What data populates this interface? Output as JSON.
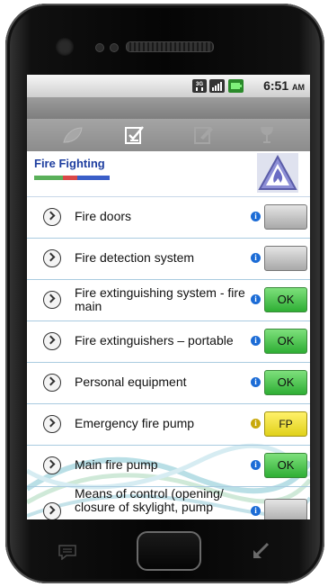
{
  "status_bar": {
    "time": "6:51",
    "ampm": "AM",
    "network": "3G"
  },
  "header": {
    "title": "Fire Fighting"
  },
  "colors": {
    "accent": "#1f3fa0",
    "ok": "#2eae34",
    "fp": "#e0d11a"
  },
  "items": [
    {
      "label": "Fire doors",
      "status": ""
    },
    {
      "label": "Fire detection system",
      "status": ""
    },
    {
      "label": "Fire extinguishing system - fire main",
      "status": "OK"
    },
    {
      "label": "Fire extinguishers – portable",
      "status": "OK"
    },
    {
      "label": "Personal equipment",
      "status": "OK"
    },
    {
      "label": "Emergency fire pump",
      "status": "FP"
    },
    {
      "label": "Main fire pump",
      "status": "OK"
    },
    {
      "label": "Means of control (opening/ closure of skylight, pump",
      "status": ""
    }
  ]
}
